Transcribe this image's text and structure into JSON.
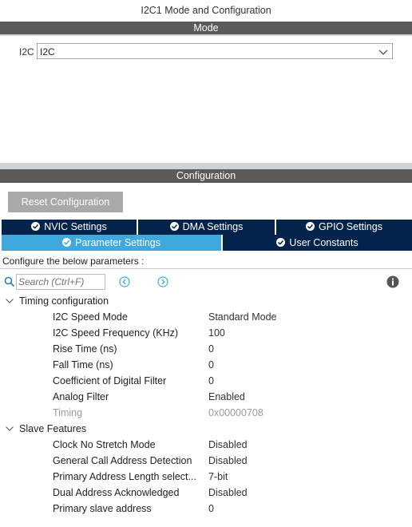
{
  "window_title": "I2C1 Mode and Configuration",
  "mode": {
    "header": "Mode",
    "field_label": "I2C",
    "selected_value": "I2C"
  },
  "configuration": {
    "header": "Configuration",
    "reset_button": "Reset Configuration",
    "tabs_row1": [
      "NVIC Settings",
      "DMA Settings",
      "GPIO Settings"
    ],
    "tabs_row2": [
      "Parameter Settings",
      "User Constants"
    ],
    "active_tab": "Parameter Settings",
    "description": "Configure the below parameters :",
    "search_placeholder": "Search (Ctrl+F)",
    "groups": [
      {
        "label": "Timing configuration",
        "params": [
          {
            "name": "I2C Speed Mode",
            "value": "Standard Mode"
          },
          {
            "name": "I2C Speed Frequency (KHz)",
            "value": "100"
          },
          {
            "name": "Rise Time (ns)",
            "value": "0"
          },
          {
            "name": "Fall Time (ns)",
            "value": "0"
          },
          {
            "name": "Coefficient of Digital Filter",
            "value": "0"
          },
          {
            "name": "Analog Filter",
            "value": "Enabled"
          },
          {
            "name": "Timing",
            "value": "0x00000708"
          }
        ]
      },
      {
        "label": "Slave Features",
        "params": [
          {
            "name": "Clock No Stretch Mode",
            "value": "Disabled"
          },
          {
            "name": "General Call Address Detection",
            "value": "Disabled"
          },
          {
            "name": "Primary Address Length select...",
            "value": "7-bit"
          },
          {
            "name": "Dual Address Acknowledged",
            "value": "Disabled"
          },
          {
            "name": "Primary slave address",
            "value": "0"
          }
        ]
      }
    ]
  },
  "colors": {
    "section_bar": "#5a5a5a",
    "tab_dark": "#03234b",
    "tab_active": "#3fa9dc",
    "button_gray": "#a9a9a9",
    "nav_icon_blue": "#3fa9dc"
  },
  "icons": [
    "chevron-down-icon",
    "check-circle-icon",
    "search-icon",
    "arrow-left-circle-icon",
    "arrow-right-circle-icon",
    "info-icon",
    "caret-down-icon"
  ]
}
